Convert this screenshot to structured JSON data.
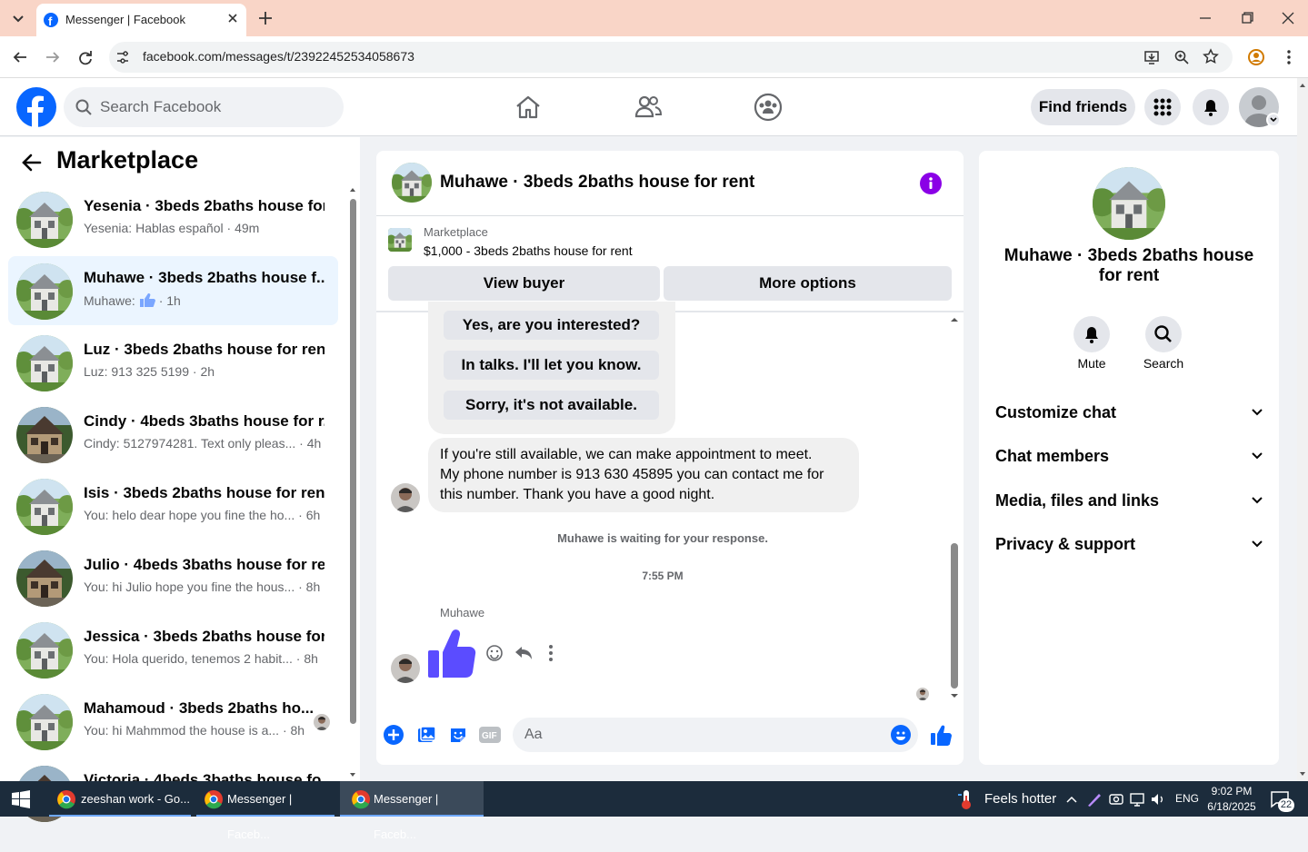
{
  "browser": {
    "tab_title": "Messenger | Facebook",
    "url": "facebook.com/messages/t/23922452534058673"
  },
  "header": {
    "search_placeholder": "Search Facebook",
    "find_friends_label": "Find friends"
  },
  "sidebar": {
    "title": "Marketplace",
    "conversations": [
      {
        "title": "Yesenia · 3beds 2baths house for...",
        "preview": "Yesenia: Hablas español",
        "time": "49m",
        "selected": false,
        "image": "house"
      },
      {
        "title": "Muhawe · 3beds 2baths house f...",
        "preview": "Muhawe:",
        "time": "1h",
        "selected": true,
        "image": "house"
      },
      {
        "title": "Luz · 3beds 2baths house for rent",
        "preview": "Luz: 913 325 5199",
        "time": "2h",
        "selected": false,
        "image": "house"
      },
      {
        "title": "Cindy · 4beds 3baths house for r...",
        "preview": "Cindy: 5127974281. Text only pleas...",
        "time": "4h",
        "selected": false,
        "image": "house2"
      },
      {
        "title": "Isis · 3beds 2baths house for rent",
        "preview": "You: helo dear hope you fine the ho...",
        "time": "6h",
        "selected": false,
        "image": "house"
      },
      {
        "title": "Julio · 4beds 3baths house for re...",
        "preview": "You: hi Julio hope you fine the hous...",
        "time": "8h",
        "selected": false,
        "image": "house2"
      },
      {
        "title": "Jessica · 3beds 2baths house for ...",
        "preview": "You: Hola querido, tenemos 2 habit...",
        "time": "8h",
        "selected": false,
        "image": "house"
      },
      {
        "title": "Mahamoud · 3beds 2baths ho...",
        "preview": "You: hi Mahmmod the house is a...",
        "time": "8h",
        "selected": false,
        "image": "house"
      },
      {
        "title": "Victoria · 4beds 3baths house fo...",
        "preview": "",
        "time": "",
        "selected": false,
        "image": "house2"
      }
    ]
  },
  "chat": {
    "title": "Muhawe · 3beds 2baths house for rent",
    "listing_source": "Marketplace",
    "listing_text": "$1,000 - 3beds 2baths house for rent",
    "view_buyer_label": "View buyer",
    "more_options_label": "More options",
    "quick_replies": [
      "Yes, are you interested?",
      "In talks. I'll let you know.",
      "Sorry, it's not available."
    ],
    "message_lines": [
      "If you're still available, we can make appointment to meet.",
      "My phone number is 913 630 45895 you can contact me for",
      "this number. Thank you have a good night."
    ],
    "waiting_text": "Muhawe is waiting for your response.",
    "timestamp": "7:55 PM",
    "sender_name": "Muhawe",
    "composer_placeholder": "Aa"
  },
  "details": {
    "title": "Muhawe · 3beds 2baths house for rent",
    "mute_label": "Mute",
    "search_label": "Search",
    "sections": [
      "Customize chat",
      "Chat members",
      "Media, files and links",
      "Privacy & support"
    ]
  },
  "taskbar": {
    "apps": [
      "zeeshan work - Go...",
      "Messenger | Faceb...",
      "Messenger | Faceb..."
    ],
    "weather": "Feels hotter",
    "language": "ENG",
    "time": "9:02 PM",
    "date": "6/18/2025",
    "notifications": "22"
  },
  "colors": {
    "accent": "#0866ff",
    "purple": "#8a00e6",
    "thumb": "#5b4cff"
  }
}
